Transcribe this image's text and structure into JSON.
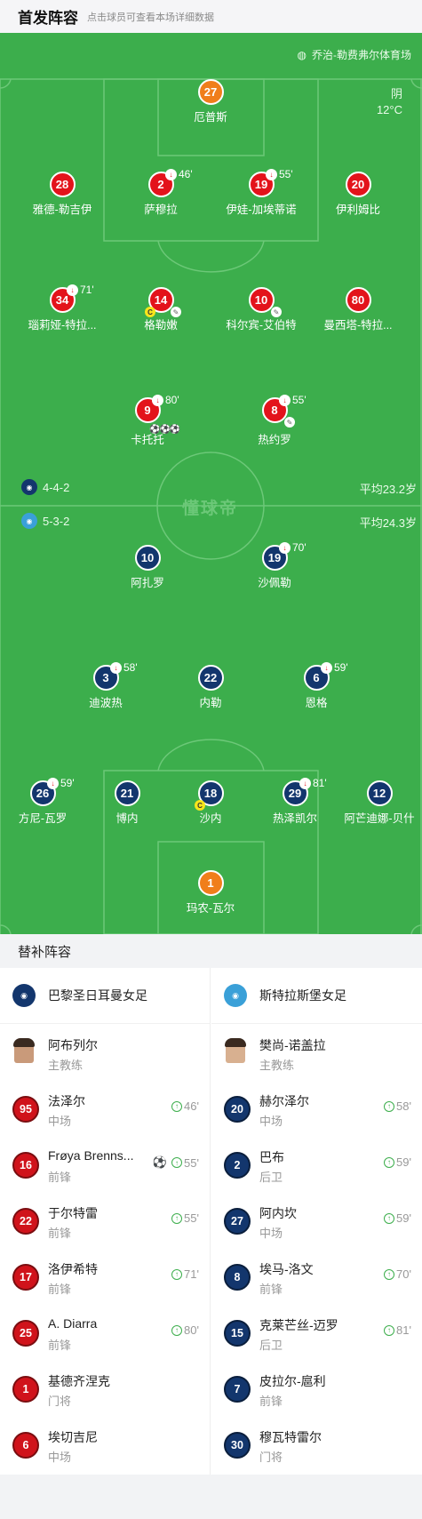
{
  "header": {
    "title": "首发阵容",
    "subtitle": "点击球员可查看本场详细数据"
  },
  "pitch": {
    "venue": "乔治-勒费弗尔体育场",
    "weather": "阴",
    "temperature": "12°C",
    "watermark": "懂球帝",
    "home": {
      "formation": "4-4-2",
      "avg_age": "平均23.2岁"
    },
    "away": {
      "formation": "5-3-2",
      "avg_age": "平均24.3岁"
    }
  },
  "home_players": [
    {
      "num": "27",
      "name": "厄普斯"
    },
    {
      "num": "28",
      "name": "雅德-勒吉伊"
    },
    {
      "num": "2",
      "name": "萨穆拉",
      "sub": "46'"
    },
    {
      "num": "19",
      "name": "伊娃-加埃蒂诺",
      "sub": "55'"
    },
    {
      "num": "20",
      "name": "伊利姆比"
    },
    {
      "num": "34",
      "name": "瑙莉娅-特拉...",
      "sub": "71'"
    },
    {
      "num": "14",
      "name": "格勒嫩",
      "card": "C"
    },
    {
      "num": "10",
      "name": "科尔宾-艾伯特"
    },
    {
      "num": "80",
      "name": "曼西塔-特拉..."
    },
    {
      "num": "9",
      "name": "卡托托",
      "sub": "80'",
      "goals": "⚽⚽⚽"
    },
    {
      "num": "8",
      "name": "热约罗",
      "sub": "55'"
    }
  ],
  "away_players": [
    {
      "num": "10",
      "name": "阿扎罗"
    },
    {
      "num": "19",
      "name": "沙佩勒",
      "sub": "70'"
    },
    {
      "num": "3",
      "name": "迪波热",
      "sub": "58'"
    },
    {
      "num": "22",
      "name": "内勒"
    },
    {
      "num": "6",
      "name": "恩格",
      "sub": "59'"
    },
    {
      "num": "26",
      "name": "方尼-瓦罗",
      "sub": "59'"
    },
    {
      "num": "21",
      "name": "博内"
    },
    {
      "num": "18",
      "name": "沙内",
      "card": "C"
    },
    {
      "num": "29",
      "name": "热泽凯尔",
      "sub": "81'"
    },
    {
      "num": "12",
      "name": "阿芒迪娜-贝什"
    },
    {
      "num": "1",
      "name": "玛农-瓦尔"
    }
  ],
  "subs": {
    "title": "替补阵容",
    "home_team": "巴黎圣日耳曼女足",
    "away_team": "斯特拉斯堡女足",
    "home_coach": {
      "name": "阿布列尔",
      "role": "主教练"
    },
    "away_coach": {
      "name": "樊尚-诺盖拉",
      "role": "主教练"
    },
    "home": [
      {
        "num": "95",
        "name": "法泽尔",
        "pos": "中场",
        "time": "46'"
      },
      {
        "num": "16",
        "name": "Frøya Brenns...",
        "pos": "前锋",
        "time": "55'",
        "goal": "⚽"
      },
      {
        "num": "22",
        "name": "于尔特雷",
        "pos": "前锋",
        "time": "55'"
      },
      {
        "num": "17",
        "name": "洛伊希特",
        "pos": "前锋",
        "time": "71'"
      },
      {
        "num": "25",
        "name": "A. Diarra",
        "pos": "前锋",
        "time": "80'"
      },
      {
        "num": "1",
        "name": "基德齐涅克",
        "pos": "门将",
        "time": ""
      },
      {
        "num": "6",
        "name": "埃切吉尼",
        "pos": "中场",
        "time": ""
      }
    ],
    "away": [
      {
        "num": "20",
        "name": "赫尔泽尔",
        "pos": "中场",
        "time": "58'"
      },
      {
        "num": "2",
        "name": "巴布",
        "pos": "后卫",
        "time": "59'"
      },
      {
        "num": "27",
        "name": "阿内坎",
        "pos": "中场",
        "time": "59'"
      },
      {
        "num": "8",
        "name": "埃马-洛文",
        "pos": "前锋",
        "time": "70'"
      },
      {
        "num": "15",
        "name": "克莱芒丝-迈罗",
        "pos": "后卫",
        "time": "81'"
      },
      {
        "num": "7",
        "name": "皮拉尔-扈利",
        "pos": "前锋",
        "time": ""
      },
      {
        "num": "30",
        "name": "穆瓦特雷尔",
        "pos": "门将",
        "time": ""
      }
    ]
  }
}
